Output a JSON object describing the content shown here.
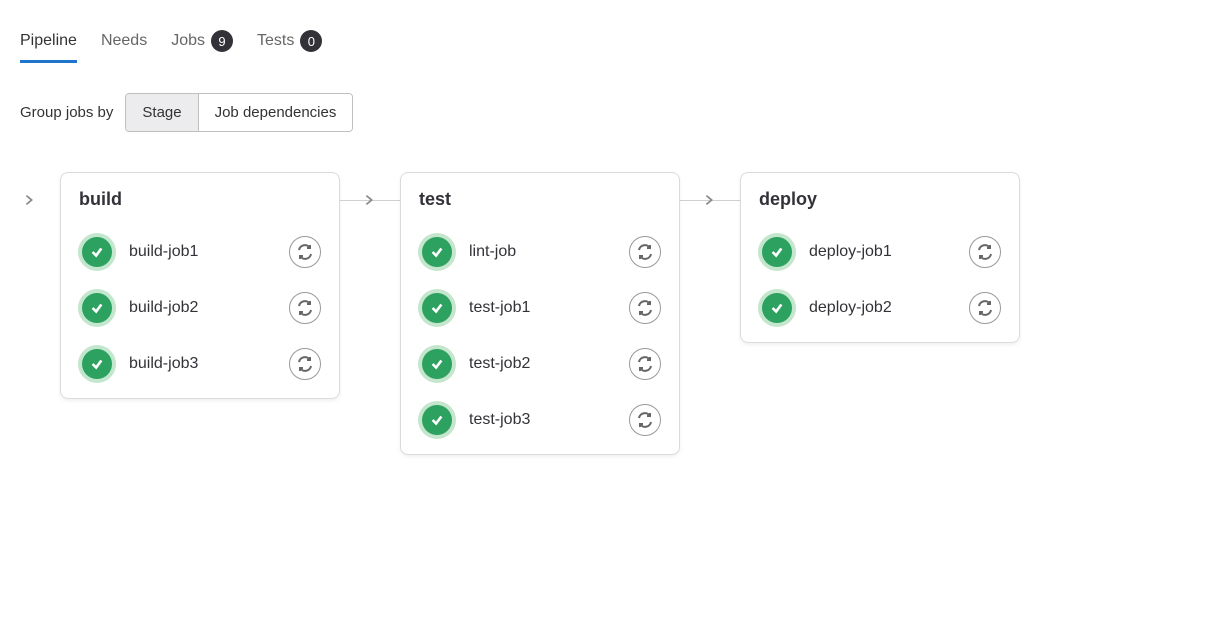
{
  "tabs": [
    {
      "label": "Pipeline",
      "active": true
    },
    {
      "label": "Needs"
    },
    {
      "label": "Jobs",
      "badge": "9"
    },
    {
      "label": "Tests",
      "badge": "0"
    }
  ],
  "groupby": {
    "label": "Group jobs by",
    "options": [
      "Stage",
      "Job dependencies"
    ],
    "active": "Stage"
  },
  "stages": [
    {
      "name": "build",
      "jobs": [
        {
          "name": "build-job1",
          "status": "success"
        },
        {
          "name": "build-job2",
          "status": "success"
        },
        {
          "name": "build-job3",
          "status": "success"
        }
      ]
    },
    {
      "name": "test",
      "jobs": [
        {
          "name": "lint-job",
          "status": "success"
        },
        {
          "name": "test-job1",
          "status": "success"
        },
        {
          "name": "test-job2",
          "status": "success"
        },
        {
          "name": "test-job3",
          "status": "success"
        }
      ]
    },
    {
      "name": "deploy",
      "jobs": [
        {
          "name": "deploy-job1",
          "status": "success"
        },
        {
          "name": "deploy-job2",
          "status": "success"
        }
      ]
    }
  ],
  "colors": {
    "success": "#2da160",
    "success_ring": "#c3e6cd",
    "tab_active_underline": "#1f75cb"
  }
}
